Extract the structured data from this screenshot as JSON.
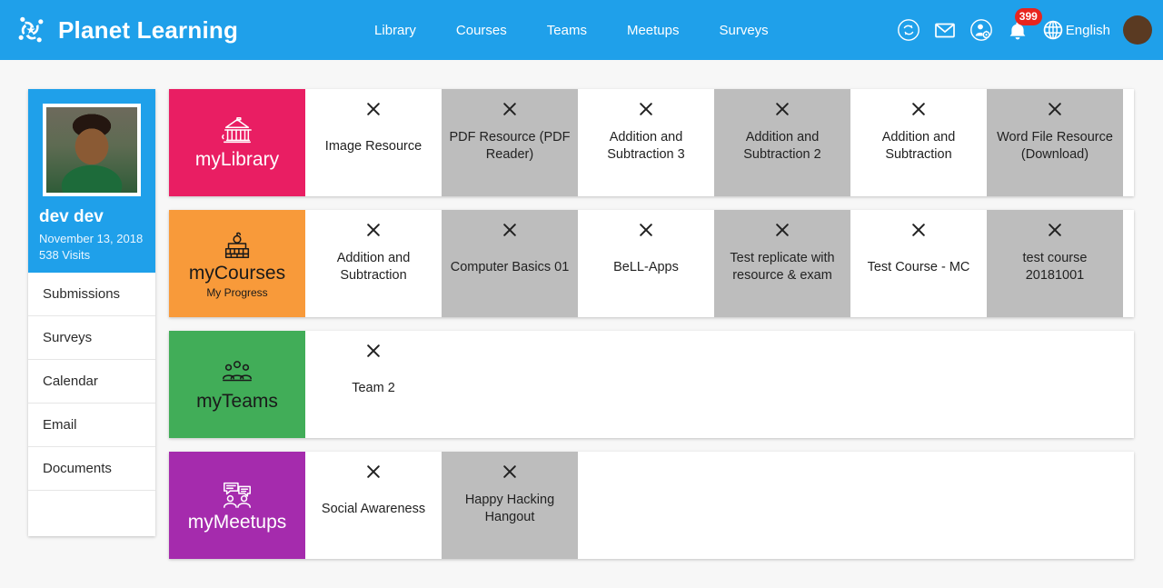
{
  "header": {
    "brand": "Planet Learning",
    "logo_icon": "planet-learning-logo",
    "nav": [
      {
        "label": "Library"
      },
      {
        "label": "Courses"
      },
      {
        "label": "Teams"
      },
      {
        "label": "Meetups"
      },
      {
        "label": "Surveys"
      }
    ],
    "tools": {
      "sync_icon": "sync-icon",
      "mail_icon": "envelope-icon",
      "user_settings_icon": "user-settings-icon",
      "bell_icon": "bell-icon",
      "notification_count": "399",
      "globe_icon": "globe-icon",
      "language": "English",
      "avatar_icon": "user-avatar"
    }
  },
  "sidebar": {
    "profile": {
      "photo_icon": "profile-photo",
      "name": "dev dev",
      "date": "November 13, 2018",
      "visits": "538 Visits"
    },
    "items": [
      {
        "label": "Submissions"
      },
      {
        "label": "Surveys"
      },
      {
        "label": "Calendar"
      },
      {
        "label": "Email"
      },
      {
        "label": "Documents"
      }
    ]
  },
  "colors": {
    "header_blue": "#1FA0EA",
    "library_pink": "#E91E63",
    "courses_orange": "#F89A3A",
    "teams_green": "#41AD58",
    "meetups_purple": "#A52BAD",
    "card_gray": "#BDBDBD",
    "card_white": "#FFFFFF",
    "badge_red": "#E8251E"
  },
  "rows": [
    {
      "key": "library",
      "label": "myLibrary",
      "sublabel": "",
      "icon": "library-building-icon",
      "tile_color": "#E91E63",
      "tile_text_color": "#FFFFFF",
      "items": [
        {
          "title": "Image Resource",
          "bg": "#FFFFFF",
          "close_icon": "close-icon"
        },
        {
          "title": "PDF Resource (PDF Reader)",
          "bg": "#BDBDBD",
          "close_icon": "close-icon"
        },
        {
          "title": "Addition and Subtraction 3",
          "bg": "#FFFFFF",
          "close_icon": "close-icon"
        },
        {
          "title": "Addition and Subtraction 2",
          "bg": "#BDBDBD",
          "close_icon": "close-icon"
        },
        {
          "title": "Addition and Subtraction",
          "bg": "#FFFFFF",
          "close_icon": "close-icon"
        },
        {
          "title": "Word File Resource (Download)",
          "bg": "#BDBDBD",
          "close_icon": "close-icon"
        }
      ]
    },
    {
      "key": "courses",
      "label": "myCourses",
      "sublabel": "My Progress",
      "icon": "books-apple-icon",
      "tile_color": "#F89A3A",
      "tile_text_color": "#1A1A1A",
      "items": [
        {
          "title": "Addition and Subtraction",
          "bg": "#FFFFFF",
          "close_icon": "close-icon"
        },
        {
          "title": "Computer Basics 01",
          "bg": "#BDBDBD",
          "close_icon": "close-icon"
        },
        {
          "title": "BeLL-Apps",
          "bg": "#FFFFFF",
          "close_icon": "close-icon"
        },
        {
          "title": "Test replicate with resource & exam",
          "bg": "#BDBDBD",
          "close_icon": "close-icon"
        },
        {
          "title": "Test Course - MC",
          "bg": "#FFFFFF",
          "close_icon": "close-icon"
        },
        {
          "title": "test course 20181001",
          "bg": "#BDBDBD",
          "close_icon": "close-icon"
        }
      ]
    },
    {
      "key": "teams",
      "label": "myTeams",
      "sublabel": "",
      "icon": "people-group-icon",
      "tile_color": "#41AD58",
      "tile_text_color": "#1A1A1A",
      "items": [
        {
          "title": "Team 2",
          "bg": "#FFFFFF",
          "close_icon": "close-icon"
        }
      ]
    },
    {
      "key": "meetups",
      "label": "myMeetups",
      "sublabel": "",
      "icon": "chat-people-icon",
      "tile_color": "#A52BAD",
      "tile_text_color": "#FFFFFF",
      "items": [
        {
          "title": "Social Awareness",
          "bg": "#FFFFFF",
          "close_icon": "close-icon"
        },
        {
          "title": "Happy Hacking Hangout",
          "bg": "#BDBDBD",
          "close_icon": "close-icon"
        }
      ]
    }
  ]
}
